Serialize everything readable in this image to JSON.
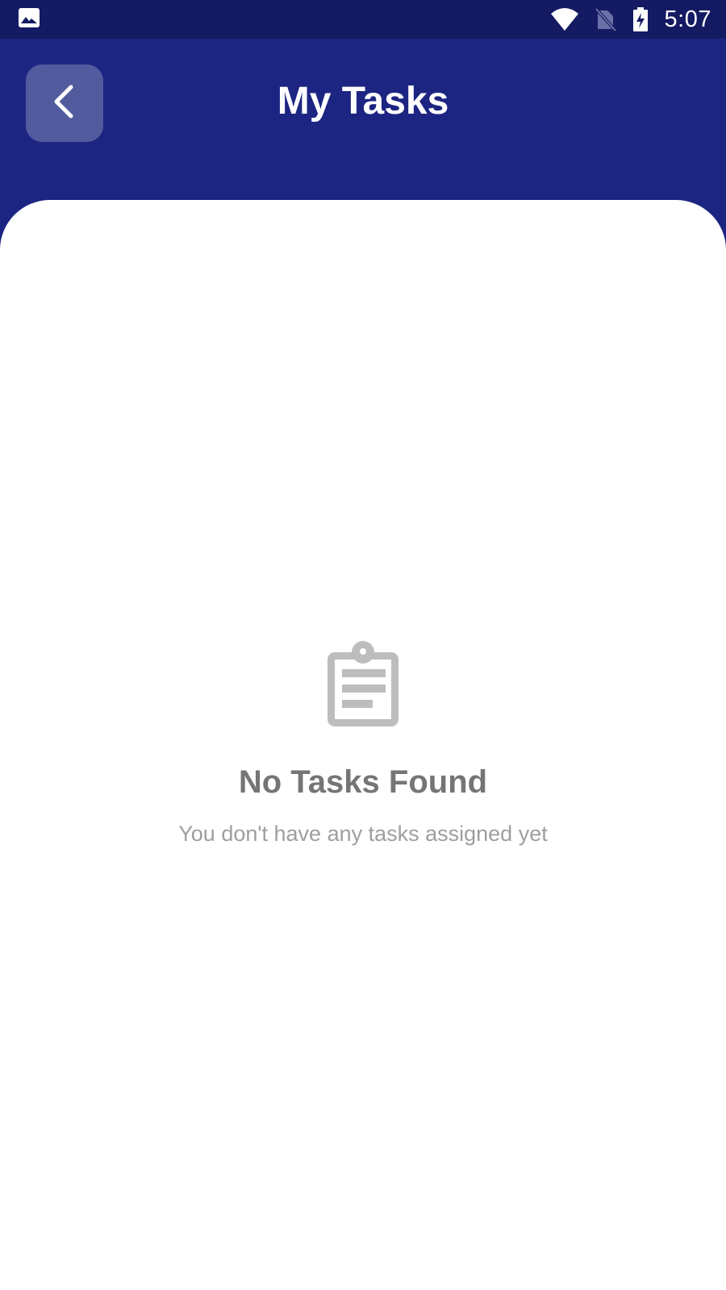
{
  "status_bar": {
    "time": "5:07",
    "icons": [
      "image-icon",
      "wifi-icon",
      "no-sim-icon",
      "battery-charging-icon"
    ]
  },
  "header": {
    "title": "My Tasks",
    "back_icon": "chevron-left-icon"
  },
  "empty_state": {
    "icon": "clipboard-icon",
    "title": "No Tasks Found",
    "subtitle": "You don't have any tasks assigned yet"
  },
  "colors": {
    "status_bar_bg": "#141b63",
    "header_bg": "#1d2582",
    "back_button_bg": "#525b9e",
    "empty_icon": "#bdbdbd",
    "empty_title": "#757575",
    "empty_subtitle": "#9e9e9e"
  }
}
